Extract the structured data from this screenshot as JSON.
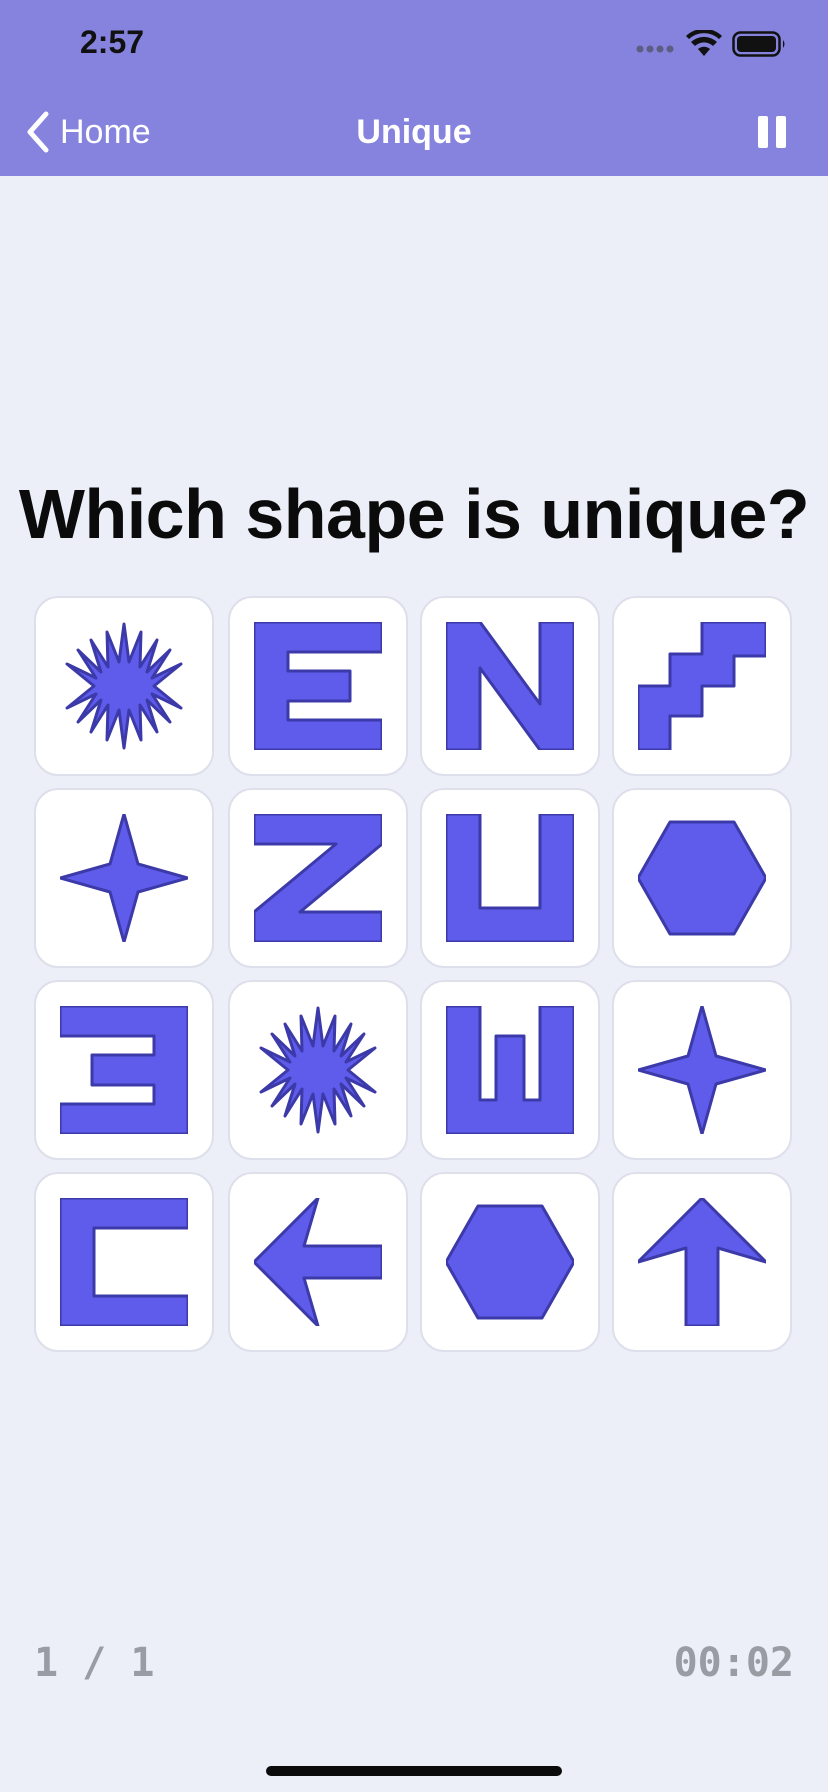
{
  "status_bar": {
    "time": "2:57"
  },
  "nav": {
    "back_label": "Home",
    "title": "Unique",
    "pause_icon": "pause-icon"
  },
  "colors": {
    "header": "#8583de",
    "shape_fill": "#5f5cec",
    "shape_stroke": "#3c3aa8",
    "background": "#eceff7"
  },
  "question": "Which shape is unique?",
  "tiles": [
    "starburst",
    "letter-e",
    "letter-n",
    "staircase",
    "four-point-star",
    "letter-z",
    "letter-u",
    "hexagon",
    "reversed-e",
    "starburst",
    "letter-w",
    "four-point-star",
    "letter-c",
    "arrow-left",
    "hexagon",
    "arrow-up"
  ],
  "footer": {
    "progress": "1 / 1",
    "timer": "00:02"
  }
}
